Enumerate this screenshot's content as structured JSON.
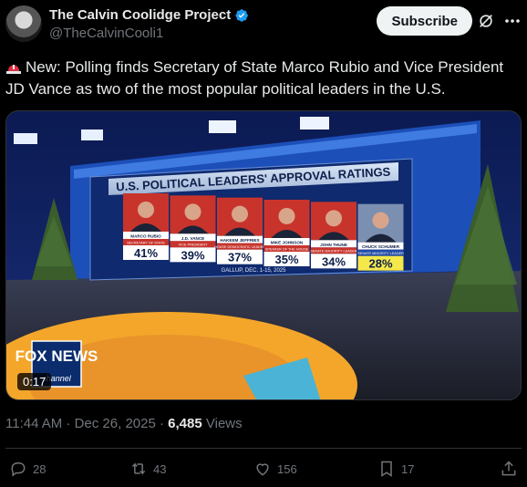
{
  "account": {
    "display_name": "The Calvin Coolidge Project",
    "handle": "@TheCalvinCooli1",
    "subscribe_label": "Subscribe"
  },
  "post": {
    "text": "New: Polling finds Secretary of State Marco Rubio and Vice President JD Vance as two of the most popular political leaders in the U.S.",
    "timestamp": "11:44 AM · Dec 26, 2025",
    "views_count": "6,485",
    "views_label": "Views"
  },
  "media": {
    "duration": "0:17",
    "graphic_title": "U.S. POLITICAL LEADERS' APPROVAL RATINGS",
    "graphic_source": "GALLUP, DEC. 1-15, 2025",
    "network_logo": "FOX NEWS",
    "network_sub": "channel",
    "leaders": [
      {
        "name": "MARCO RUBIO",
        "title": "SECRETARY OF STATE",
        "approval": "41%"
      },
      {
        "name": "J.D. VANCE",
        "title": "VICE PRESIDENT",
        "approval": "39%"
      },
      {
        "name": "HAKEEM JEFFRIES",
        "title": "HOUSE DEMOCRATIC LEADER",
        "approval": "37%"
      },
      {
        "name": "MIKE JOHNSON",
        "title": "SPEAKER OF THE HOUSE",
        "approval": "35%"
      },
      {
        "name": "JOHN THUNE",
        "title": "SENATE MAJORITY LEADER",
        "approval": "34%"
      },
      {
        "name": "CHUCK SCHUMER",
        "title": "SENATE MINORITY LEADER",
        "approval": "28%"
      }
    ]
  },
  "actions": {
    "replies": "28",
    "reposts": "43",
    "likes": "156",
    "bookmarks": "17"
  },
  "icons": [
    "verified-badge-icon",
    "grok-icon",
    "more-icon",
    "siren-emoji-icon",
    "reply-icon",
    "repost-icon",
    "like-icon",
    "bookmark-icon",
    "share-icon"
  ],
  "colors": {
    "background": "#000000",
    "text": "#e7e9ea",
    "secondary": "#71767b",
    "verified": "#1d9bf0",
    "subscribe_bg": "#eff3f4"
  }
}
